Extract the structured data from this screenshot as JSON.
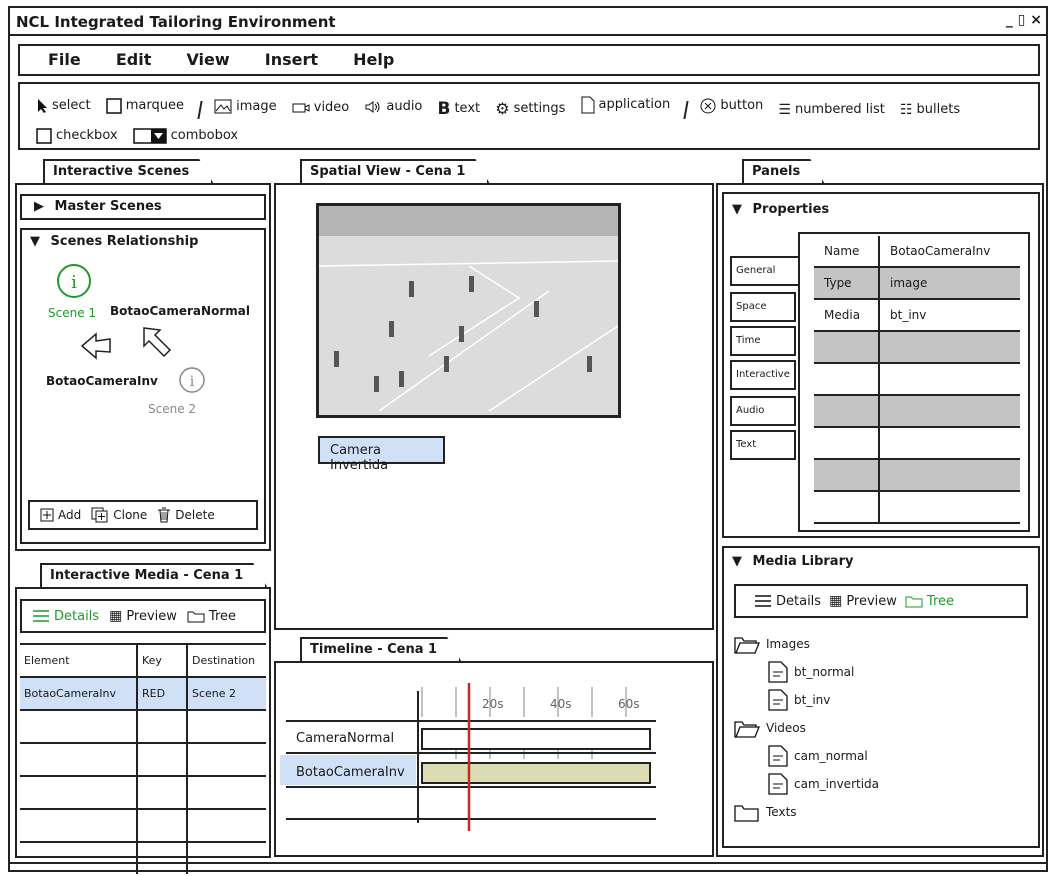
{
  "window": {
    "title": "NCL Integrated Tailoring Environment",
    "controls": "_ ▯ ×"
  },
  "menu": {
    "items": [
      "File",
      "Edit",
      "View",
      "Insert",
      "Help"
    ]
  },
  "toolbar": {
    "select": "select",
    "marquee": "marquee",
    "image": "image",
    "video": "video",
    "audio": "audio",
    "text": "text",
    "settings": "settings",
    "application": "application",
    "button": "button",
    "numbered_list": "numbered list",
    "bullets": "bullets",
    "checkbox": "checkbox",
    "combobox": "combobox"
  },
  "scenes_panel": {
    "tab": "Interactive Scenes",
    "master_scenes": "Master Scenes",
    "relationship_title": "Scenes Relationship",
    "scene1_label": "Scene 1",
    "scene2_label": "Scene 2",
    "node_normal": "BotaoCameraNormal",
    "node_inv": "BotaoCameraInv",
    "add": "Add",
    "clone": "Clone",
    "delete": "Delete"
  },
  "interactive_media": {
    "tab": "Interactive Media - Cena 1",
    "views": {
      "details": "Details",
      "preview": "Preview",
      "tree": "Tree"
    },
    "columns": [
      "Element",
      "Key",
      "Destination"
    ],
    "rows": [
      {
        "element": "BotaoCameraInv",
        "key": "RED",
        "destination": "Scene 2"
      }
    ]
  },
  "spatial": {
    "tab": "Spatial View - Cena 1",
    "button_label": "Camera Invertida"
  },
  "timeline": {
    "tab": "Timeline - Cena 1",
    "ticks": [
      "20s",
      "40s",
      "60s"
    ],
    "tracks": [
      "CameraNormal",
      "BotaoCameraInv"
    ]
  },
  "panels": {
    "tab": "Panels",
    "properties_title": "Properties",
    "side_tabs": [
      "General",
      "Space",
      "Time",
      "Interactive",
      "Audio",
      "Text"
    ],
    "props": [
      {
        "name": "Name",
        "value": "BotaoCameraInv"
      },
      {
        "name": "Type",
        "value": "image"
      },
      {
        "name": "Media",
        "value": "bt_inv"
      }
    ]
  },
  "media_library": {
    "title": "Media Library",
    "views": {
      "details": "Details",
      "preview": "Preview",
      "tree": "Tree"
    },
    "folders": {
      "images": "Images",
      "bt_normal": "bt_normal",
      "bt_inv": "bt_inv",
      "videos": "Videos",
      "cam_normal": "cam_normal",
      "cam_invertida": "cam_invertida",
      "texts": "Texts"
    }
  },
  "colors": {
    "accent_green": "#1f9a2b",
    "selection_blue": "#cfe0f7",
    "track_bar": "#dcdcb4",
    "playhead": "#c62828"
  }
}
